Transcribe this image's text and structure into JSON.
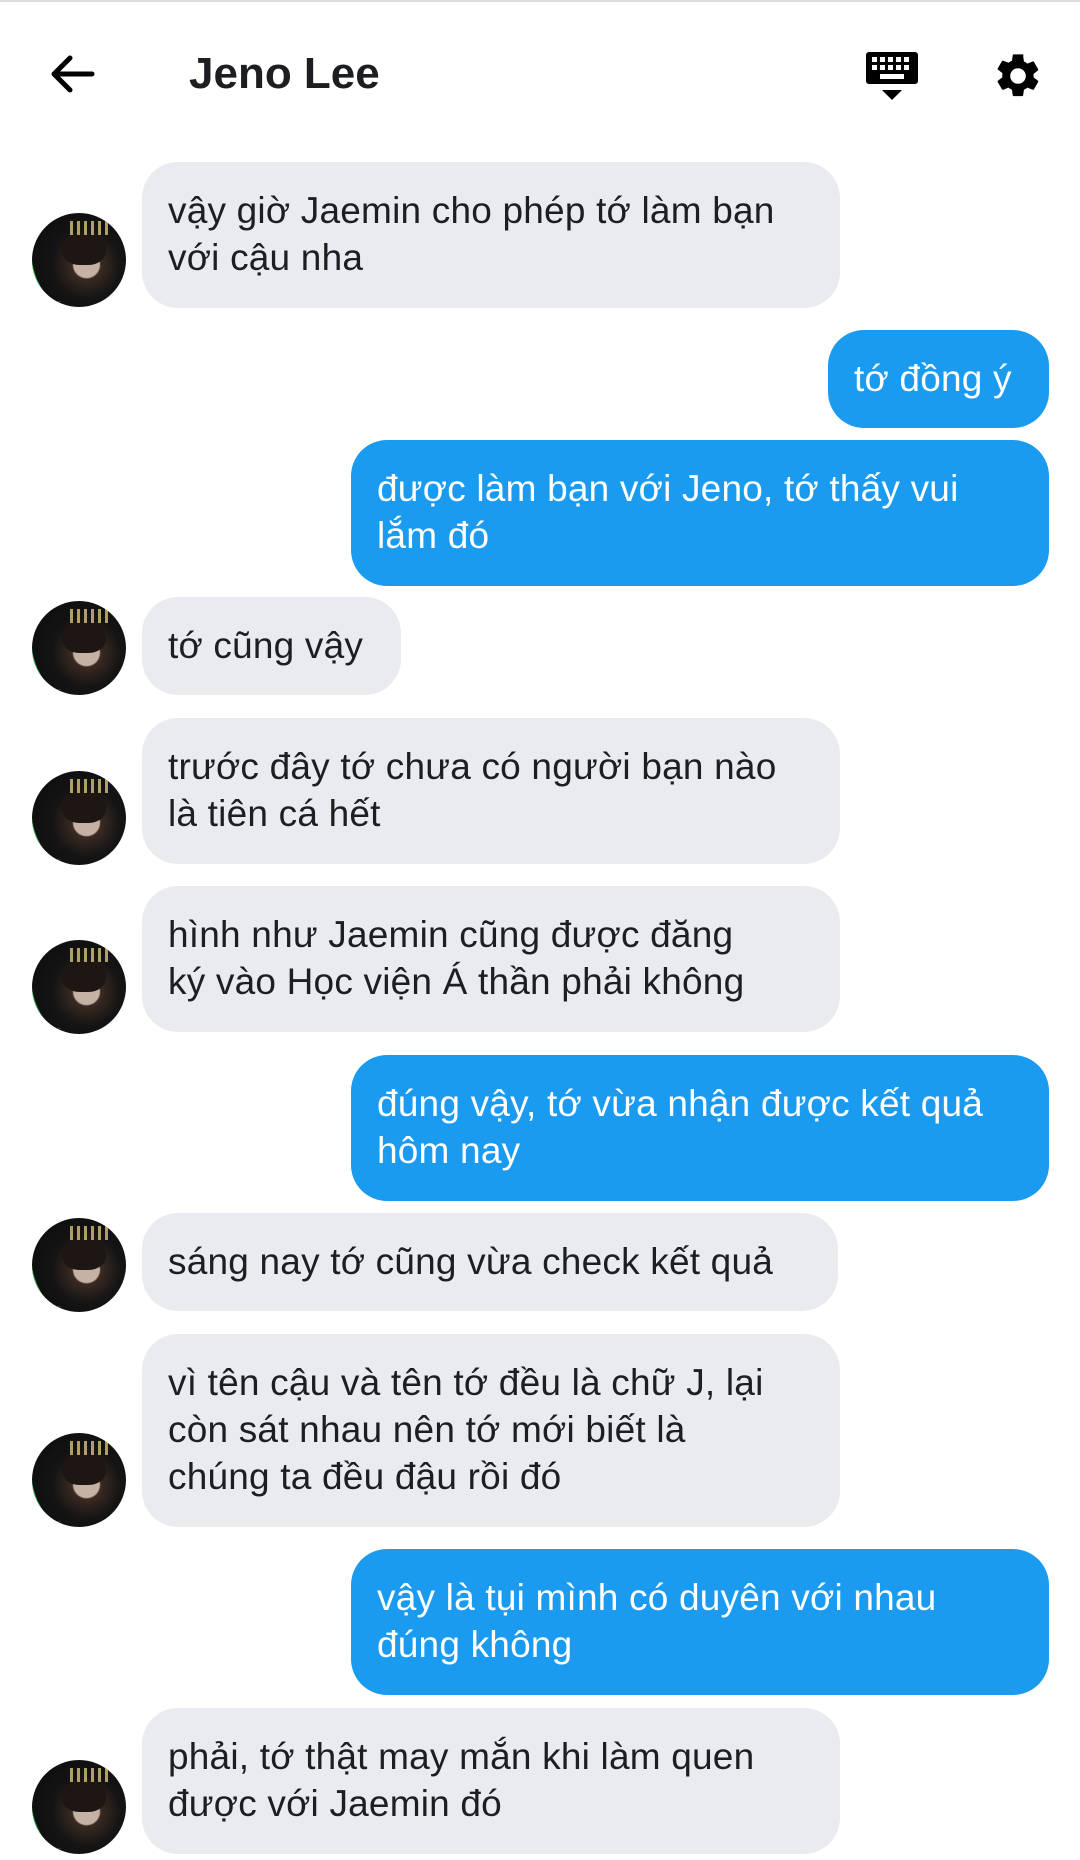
{
  "header": {
    "title": "Jeno Lee",
    "back_icon": "arrow-left-icon",
    "keyboard_icon": "keyboard-hide-icon",
    "settings_icon": "gear-icon"
  },
  "colors": {
    "incoming_bubble": "#e9ebee",
    "outgoing_bubble": "#1a9bf0",
    "outgoing_text": "#ffffff",
    "incoming_text": "#1c1e21"
  },
  "messages": [
    {
      "from": "contact",
      "text": "vậy giờ Jaemin cho phép tớ làm bạn\nvới cậu nha"
    },
    {
      "from": "me",
      "text": "tớ đồng ý"
    },
    {
      "from": "me",
      "text": "được làm bạn với Jeno, tớ thấy vui\nlắm đó"
    },
    {
      "from": "contact",
      "text": "tớ cũng vậy"
    },
    {
      "from": "contact",
      "text": "trước đây tớ chưa có người bạn nào\nlà tiên cá hết"
    },
    {
      "from": "contact",
      "text": "hình như Jaemin cũng được đăng\nký vào Học viện Á thần phải không"
    },
    {
      "from": "me",
      "text": "đúng vậy, tớ vừa nhận được kết quả\nhôm nay"
    },
    {
      "from": "contact",
      "text": "sáng nay tớ cũng vừa check kết quả"
    },
    {
      "from": "contact",
      "text": "vì tên cậu và tên tớ đều là chữ J, lại\ncòn sát nhau nên tớ mới biết là\nchúng ta đều đậu rồi đó"
    },
    {
      "from": "me",
      "text": "vậy là tụi mình có duyên với nhau\nđúng không"
    },
    {
      "from": "contact",
      "text": "phải, tớ thật may mắn khi làm quen\nđược với Jaemin đó"
    }
  ]
}
